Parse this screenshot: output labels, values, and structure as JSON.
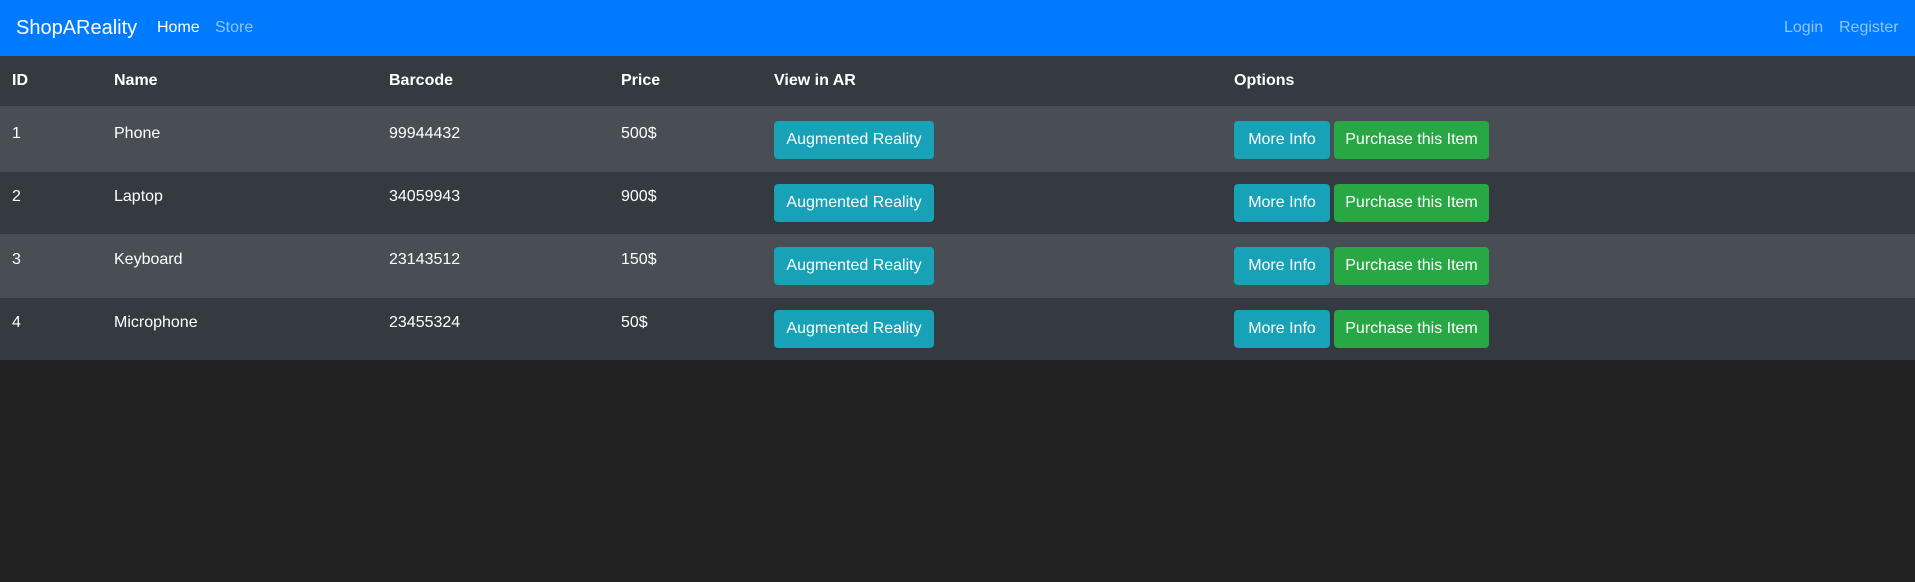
{
  "navbar": {
    "brand": "ShopAReality",
    "home": "Home",
    "store": "Store",
    "login": "Login",
    "register": "Register"
  },
  "table": {
    "headers": [
      "ID",
      "Name",
      "Barcode",
      "Price",
      "View in AR",
      "Options"
    ],
    "rows": [
      {
        "id": "1",
        "name": "Phone",
        "barcode": "99944432",
        "price": "500$"
      },
      {
        "id": "2",
        "name": "Laptop",
        "barcode": "34059943",
        "price": "900$"
      },
      {
        "id": "3",
        "name": "Keyboard",
        "barcode": "23143512",
        "price": "150$"
      },
      {
        "id": "4",
        "name": "Microphone",
        "barcode": "23455324",
        "price": "50$"
      }
    ],
    "ar_button_label": "Augmented Reality",
    "more_info_label": "More Info",
    "purchase_label": "Purchase this Item"
  },
  "colors": {
    "navbar": "#007bff",
    "info_button": "#17a2b8",
    "success_button": "#28a745",
    "page_background": "#222222",
    "table_dark": "#343a40",
    "table_striped": "#494e55"
  }
}
